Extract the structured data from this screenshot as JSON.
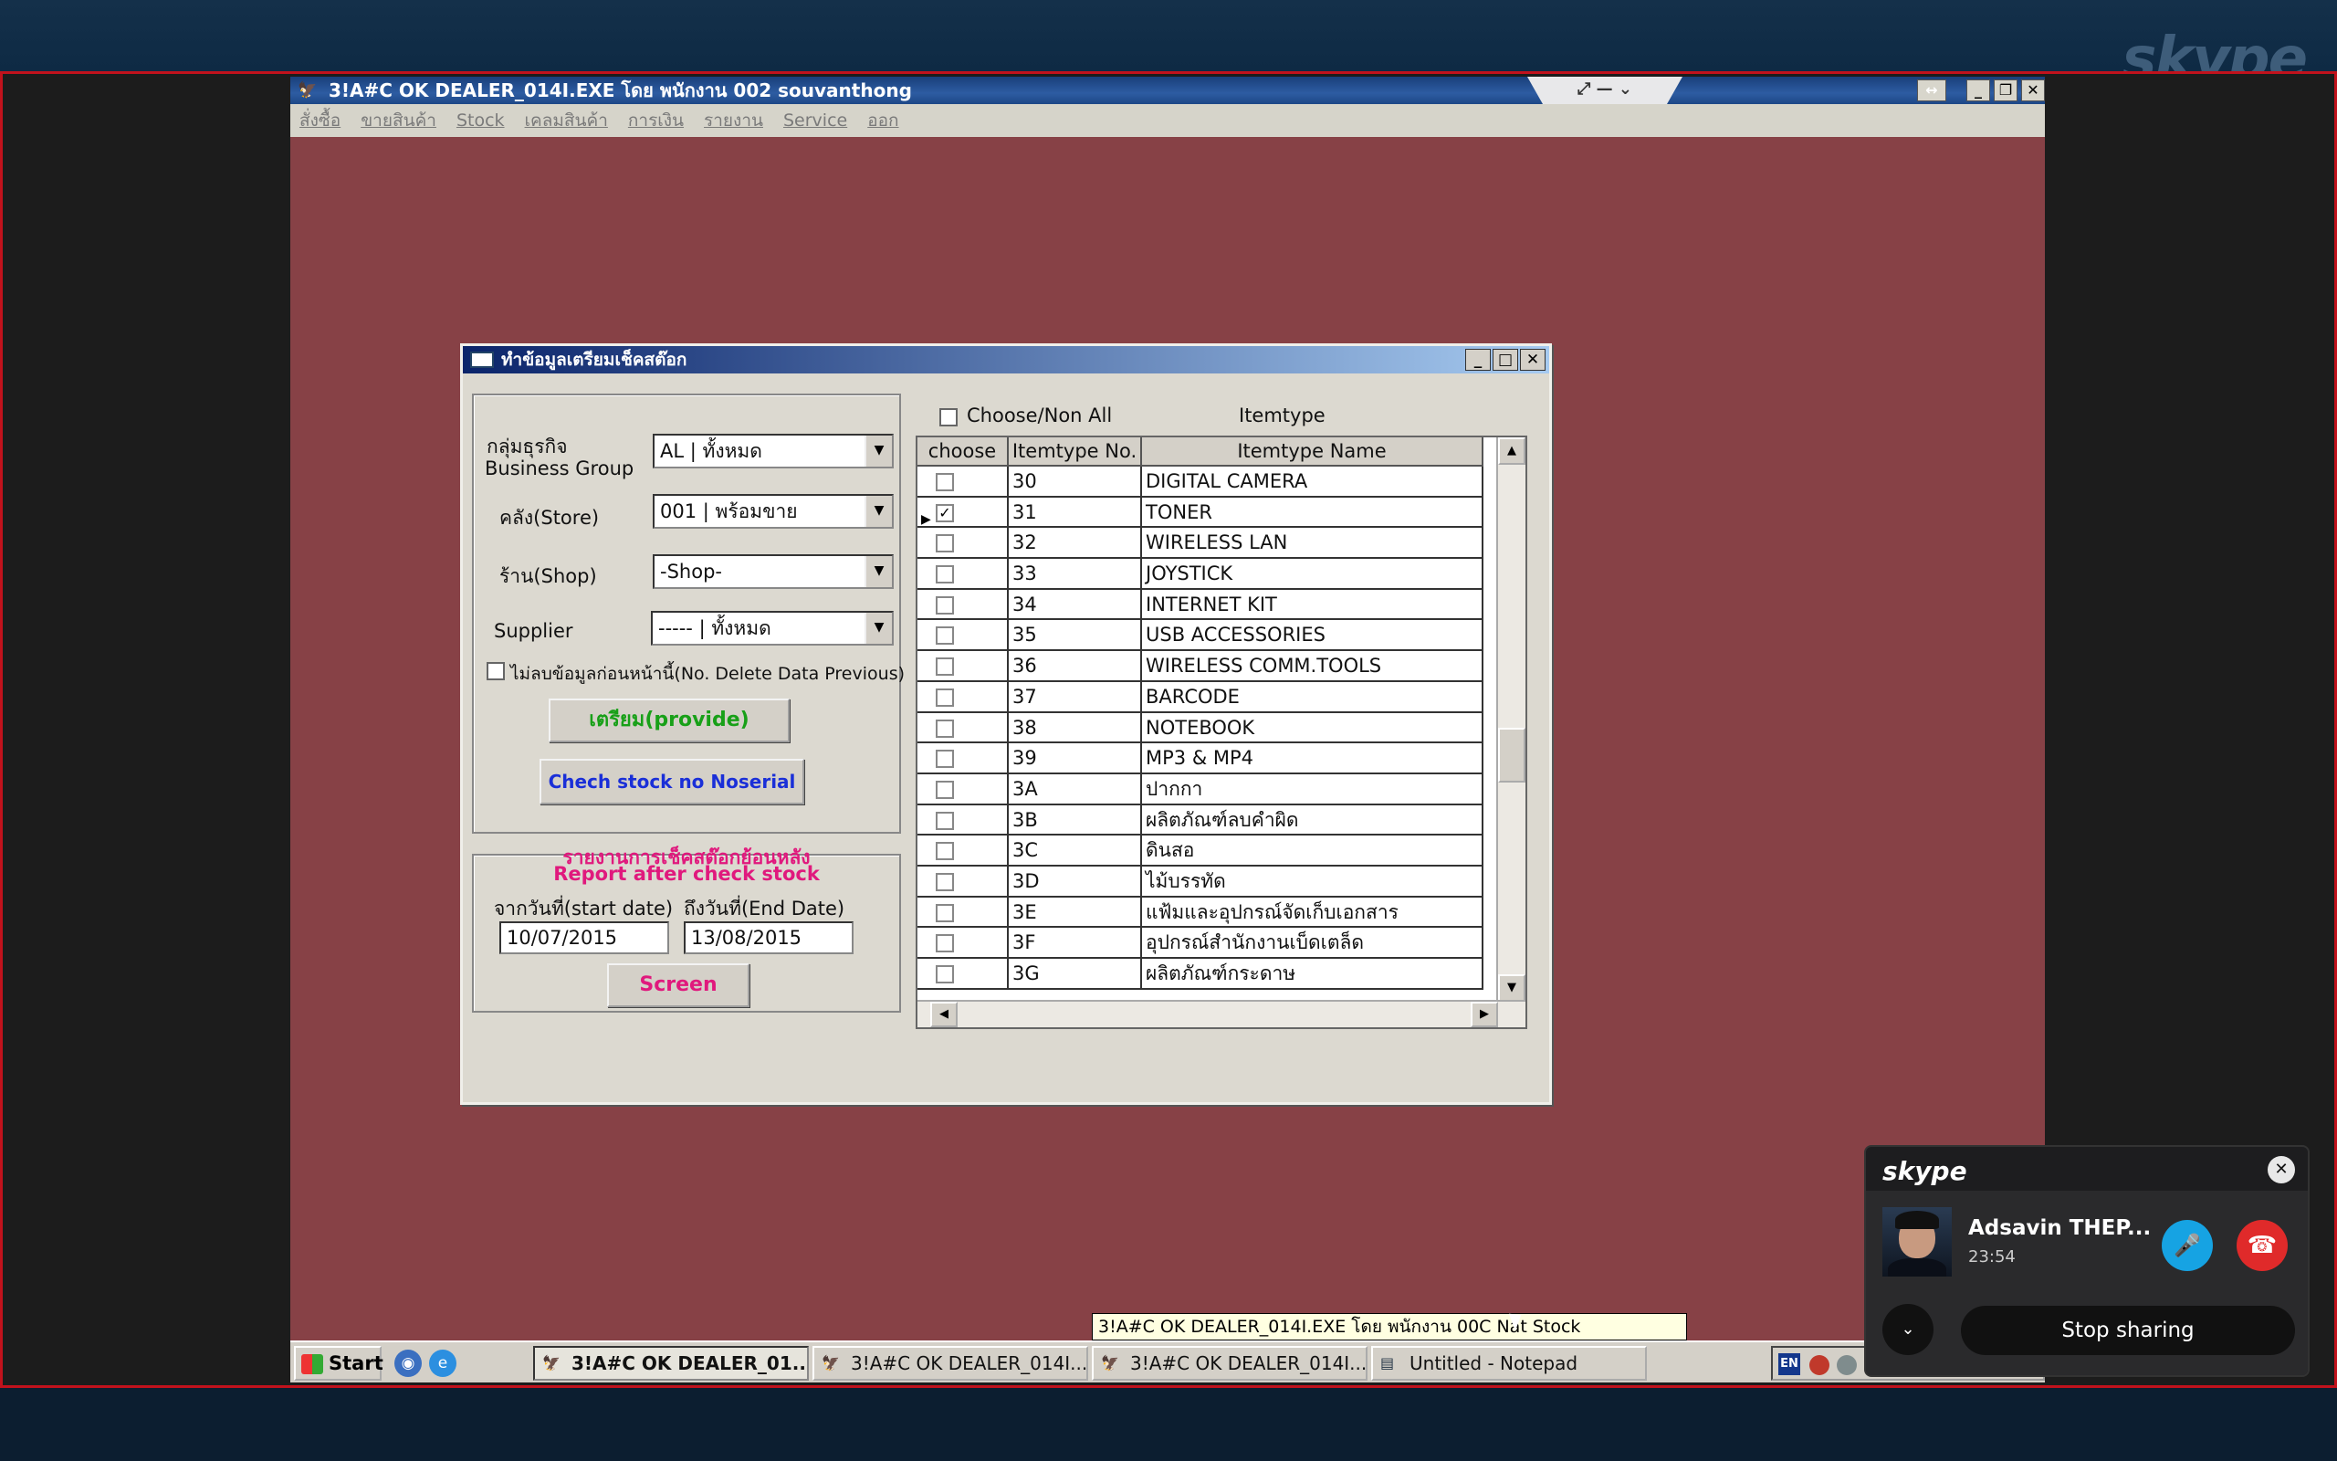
{
  "meeting": {
    "logo": "skype",
    "colors": {
      "frame": "#c1121c",
      "mic": "#16a3e3",
      "hangup": "#e02a2a"
    }
  },
  "app": {
    "title": "3!A#C OK DEALER_014I.EXE โดย พนักงาน 002 souvanthong",
    "menu": [
      "สั่งซื้อ",
      "ขายสินค้า",
      "Stock",
      "เคลมสินค้า",
      "การเงิน",
      "รายงาน",
      "Service",
      "ออก"
    ]
  },
  "dialog": {
    "title": "ทำข้อมูลเตรียมเช็คสต๊อก",
    "business_group_label_th": "กลุ่มธุรกิจ",
    "business_group_label_en": "Business Group",
    "business_group_value": "AL | ทั้งหมด",
    "store_label": "คลัง(Store)",
    "store_value": "001 | พร้อมขาย",
    "shop_label": "ร้าน(Shop)",
    "shop_value": "-Shop-",
    "supplier_label": "Supplier",
    "supplier_value": "----- | ทั้งหมด",
    "no_delete_label": "ไม่ลบข้อมูลก่อนหน้านี้(No. Delete Data Previous)",
    "provide_button": "เตรียม(provide)",
    "check_stock_button": "Chech stock no  Noserial",
    "report_title_th": "รายงานการเช็คสต๊อกย้อนหลัง",
    "report_title_en": "Report after check stock",
    "start_date_label": "จากวันที่(start date)",
    "end_date_label": "ถึงวันที่(End Date)",
    "start_date": "10/07/2015",
    "end_date": "13/08/2015",
    "screen_button": "Screen",
    "choose_all_label": "Choose/Non All",
    "itemtype_caption": "Itemtype",
    "grid": {
      "columns": [
        "choose",
        "Itemtype No.",
        "Itemtype Name"
      ],
      "rows": [
        {
          "no": "30",
          "name": "DIGITAL CAMERA",
          "checked": false
        },
        {
          "no": "31",
          "name": "TONER",
          "checked": true,
          "current": true
        },
        {
          "no": "32",
          "name": "WIRELESS LAN",
          "checked": false
        },
        {
          "no": "33",
          "name": "JOYSTICK",
          "checked": false
        },
        {
          "no": "34",
          "name": "INTERNET KIT",
          "checked": false
        },
        {
          "no": "35",
          "name": "USB ACCESSORIES",
          "checked": false
        },
        {
          "no": "36",
          "name": "WIRELESS COMM.TOOLS",
          "checked": false
        },
        {
          "no": "37",
          "name": "BARCODE",
          "checked": false
        },
        {
          "no": "38",
          "name": "NOTEBOOK",
          "checked": false
        },
        {
          "no": "39",
          "name": "MP3 & MP4",
          "checked": false
        },
        {
          "no": "3A",
          "name": "ปากกา",
          "checked": false
        },
        {
          "no": "3B",
          "name": "ผลิตภัณฑ์ลบคำผิด",
          "checked": false
        },
        {
          "no": "3C",
          "name": "ดินสอ",
          "checked": false
        },
        {
          "no": "3D",
          "name": "ไม้บรรทัด",
          "checked": false
        },
        {
          "no": "3E",
          "name": "แฟ้มและอุปกรณ์จัดเก็บเอกสาร",
          "checked": false
        },
        {
          "no": "3F",
          "name": "อุปกรณ์สำนักงานเบ็ดเตล็ด",
          "checked": false
        },
        {
          "no": "3G",
          "name": "ผลิตภัณฑ์กระดาษ",
          "checked": false
        }
      ]
    }
  },
  "taskbar": {
    "start": "Start",
    "tasks": [
      "3!A#C OK DEALER_01...",
      "3!A#C OK DEALER_014I...",
      "3!A#C OK DEALER_014I...",
      "Untitled - Notepad"
    ],
    "tray_lang": "EN",
    "tooltip": "3!A#C OK DEALER_014I.EXE โดย พนักงาน 00C Nat Stock"
  },
  "call": {
    "logo": "skype",
    "caller_name": "Adsavin THEP...",
    "duration": "23:54",
    "stop_sharing": "Stop sharing"
  }
}
